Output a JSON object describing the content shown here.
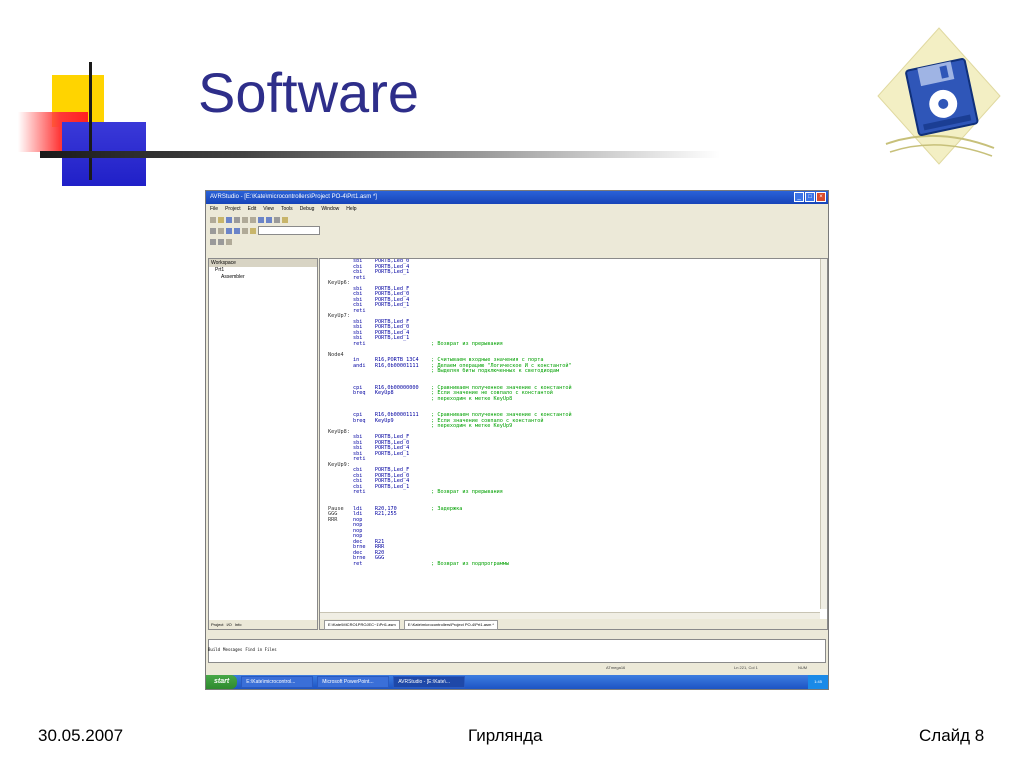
{
  "slide": {
    "title": "Software",
    "footer_date": "30.05.2007",
    "footer_center": "Гирлянда",
    "footer_slide": "Слайд 8"
  },
  "colors": {
    "title": "#2e2e8a",
    "deco_yellow": "#ffd400",
    "deco_red": "#ff3838",
    "deco_blue": "#2b2bd0",
    "disk_blue": "#2f56b8"
  },
  "app": {
    "window_title": "AVRStudio - [E:\\Kate\\microcontrollers\\Project PO-4\\Prt1.asm *]",
    "menu": [
      "File",
      "Project",
      "Edit",
      "View",
      "Tools",
      "Debug",
      "Window",
      "Help"
    ],
    "workspace_title": "Workspace",
    "tree": [
      "Prt1",
      "Assembler"
    ],
    "workspace_tabs": [
      "Project",
      "I/O",
      "Info"
    ],
    "editor_tabs": [
      "E:\\Kate\\MICRO1PROJEC~1\\Prt1.asm",
      "E:\\Kate\\microcontrollers\\Project PO-4\\Prt1.asm *"
    ],
    "message_tabs": [
      "Build",
      "Messages",
      "Find in Files"
    ],
    "status": "ATmega16",
    "status_pos": "Ln 221, Col 1",
    "status_num": "NUM",
    "taskbar": {
      "start": "start",
      "tasks": [
        "E:\\Kate\\microcontrol...",
        "Microsoft PowerPoint...",
        "AVRStudio - [E:\\Kate\\..."
      ],
      "clock": "1:45"
    },
    "code_lines": [
      {
        "l": "",
        "o": "sbi",
        "a": "PORTB,Led_0",
        "c": ""
      },
      {
        "l": "",
        "o": "cbi",
        "a": "PORTB,Led_4",
        "c": ""
      },
      {
        "l": "",
        "o": "cbi",
        "a": "PORTB,Led_1",
        "c": ""
      },
      {
        "l": "",
        "o": "reti",
        "a": "",
        "c": ""
      },
      {
        "l": "KeyUp6:",
        "o": "",
        "a": "",
        "c": ""
      },
      {
        "l": "",
        "o": "sbi",
        "a": "PORTB,Led_F",
        "c": ""
      },
      {
        "l": "",
        "o": "cbi",
        "a": "PORTB,Led_0",
        "c": ""
      },
      {
        "l": "",
        "o": "sbi",
        "a": "PORTB,Led_4",
        "c": ""
      },
      {
        "l": "",
        "o": "cbi",
        "a": "PORTB,Led_1",
        "c": ""
      },
      {
        "l": "",
        "o": "reti",
        "a": "",
        "c": ""
      },
      {
        "l": "KeyUp7:",
        "o": "",
        "a": "",
        "c": ""
      },
      {
        "l": "",
        "o": "sbi",
        "a": "PORTB,Led_F",
        "c": ""
      },
      {
        "l": "",
        "o": "sbi",
        "a": "PORTB,Led_0",
        "c": ""
      },
      {
        "l": "",
        "o": "sbi",
        "a": "PORTB,Led_4",
        "c": ""
      },
      {
        "l": "",
        "o": "sbi",
        "a": "PORTB,Led_1",
        "c": ""
      },
      {
        "l": "",
        "o": "reti",
        "a": "",
        "c": "; Возврат из прерывания"
      },
      {
        "l": "",
        "o": "",
        "a": "",
        "c": ""
      },
      {
        "l": "Node4",
        "o": "",
        "a": "",
        "c": ""
      },
      {
        "l": "",
        "o": "in",
        "a": "R16,PORTB 13C4",
        "c": "; Считываем входные значения с порта"
      },
      {
        "l": "",
        "o": "andi",
        "a": "R16,0b00001111",
        "c": "; Делаем операцию \"Логическое И с константой\""
      },
      {
        "l": "",
        "o": "",
        "a": "",
        "c": "; Выделяя биты подключенных к светодиодам"
      },
      {
        "l": "",
        "o": "",
        "a": "",
        "c": ""
      },
      {
        "l": "",
        "o": "",
        "a": "",
        "c": ""
      },
      {
        "l": "",
        "o": "cpi",
        "a": "R16,0b00000000",
        "c": "; Сравниваем полученное значение с константой"
      },
      {
        "l": "",
        "o": "breq",
        "a": "KeyUp8",
        "c": "; Если значение не совпало с константой"
      },
      {
        "l": "",
        "o": "",
        "a": "",
        "c": "; переходим к метке KeyUp8"
      },
      {
        "l": "",
        "o": "",
        "a": "",
        "c": ""
      },
      {
        "l": "",
        "o": "",
        "a": "",
        "c": ""
      },
      {
        "l": "",
        "o": "cpi",
        "a": "R16,0b00001111",
        "c": "; Сравниваем полученное значение с константой"
      },
      {
        "l": "",
        "o": "breq",
        "a": "KeyUp9",
        "c": "; Если значение совпало с константой"
      },
      {
        "l": "",
        "o": "",
        "a": "",
        "c": "; переходим к метке KeyUp9"
      },
      {
        "l": "KeyUp8:",
        "o": "",
        "a": "",
        "c": ""
      },
      {
        "l": "",
        "o": "sbi",
        "a": "PORTB,Led_F",
        "c": ""
      },
      {
        "l": "",
        "o": "sbi",
        "a": "PORTB,Led_0",
        "c": ""
      },
      {
        "l": "",
        "o": "sbi",
        "a": "PORTB,Led_4",
        "c": ""
      },
      {
        "l": "",
        "o": "sbi",
        "a": "PORTB,Led_1",
        "c": ""
      },
      {
        "l": "",
        "o": "reti",
        "a": "",
        "c": ""
      },
      {
        "l": "KeyUp9:",
        "o": "",
        "a": "",
        "c": ""
      },
      {
        "l": "",
        "o": "cbi",
        "a": "PORTB,Led_F",
        "c": ""
      },
      {
        "l": "",
        "o": "cbi",
        "a": "PORTB,Led_0",
        "c": ""
      },
      {
        "l": "",
        "o": "cbi",
        "a": "PORTB,Led_4",
        "c": ""
      },
      {
        "l": "",
        "o": "cbi",
        "a": "PORTB,Led_1",
        "c": ""
      },
      {
        "l": "",
        "o": "reti",
        "a": "",
        "c": "; Возврат из прерывания"
      },
      {
        "l": "",
        "o": "",
        "a": "",
        "c": ""
      },
      {
        "l": "",
        "o": "",
        "a": "",
        "c": ""
      },
      {
        "l": "Pause",
        "o": "ldi",
        "a": "R20,170",
        "c": "; Задержка"
      },
      {
        "l": "GGG",
        "o": "ldi",
        "a": "R21,255",
        "c": ""
      },
      {
        "l": "RRR",
        "o": "nop",
        "a": "",
        "c": ""
      },
      {
        "l": "",
        "o": "nop",
        "a": "",
        "c": ""
      },
      {
        "l": "",
        "o": "nop",
        "a": "",
        "c": ""
      },
      {
        "l": "",
        "o": "nop",
        "a": "",
        "c": ""
      },
      {
        "l": "",
        "o": "dec",
        "a": "R21",
        "c": ""
      },
      {
        "l": "",
        "o": "brne",
        "a": "RRR",
        "c": ""
      },
      {
        "l": "",
        "o": "dec",
        "a": "R20",
        "c": ""
      },
      {
        "l": "",
        "o": "brne",
        "a": "GGG",
        "c": ""
      },
      {
        "l": "",
        "o": "ret",
        "a": "",
        "c": "; Возврат из подпрограммы"
      }
    ]
  }
}
